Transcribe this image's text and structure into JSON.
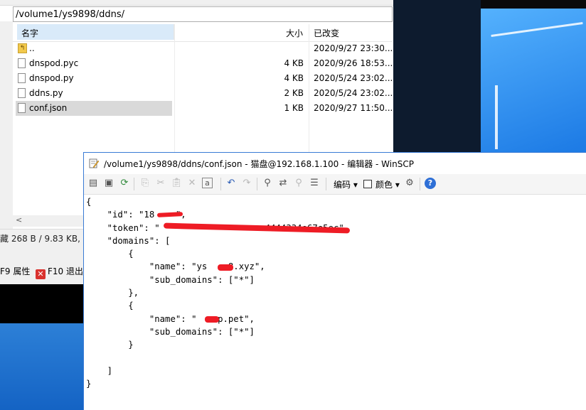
{
  "file_panel": {
    "path": "/volume1/ys9898/ddns/",
    "columns": {
      "name": "名字",
      "size": "大小",
      "modified": "已改变"
    },
    "rows": [
      {
        "name": "..",
        "size": "",
        "modified": "2020/9/27 23:30..."
      },
      {
        "name": "dnspod.pyc",
        "size": "4 KB",
        "modified": "2020/9/26 18:53..."
      },
      {
        "name": "dnspod.py",
        "size": "4 KB",
        "modified": "2020/5/24 23:02..."
      },
      {
        "name": "ddns.py",
        "size": "2 KB",
        "modified": "2020/5/24 23:02..."
      },
      {
        "name": "conf.json",
        "size": "1 KB",
        "modified": "2020/9/27 11:50..."
      }
    ],
    "status": "藏  268 B / 9.83 KB,",
    "fkeys": {
      "f9": "F9 属性",
      "f10": "F10 退出"
    }
  },
  "editor": {
    "title": "/volume1/ys9898/ddns/conf.json - 猫盘@192.168.1.100 - 编辑器 - WinSCP",
    "encoding_label": "编码 ▾",
    "color_label": "颜色 ▾",
    "help_icon": "?",
    "code_lines": [
      "{",
      "    \"id\": \"18    \",",
      "    \"token\": \"                    4444334e67e5ec\",",
      "    \"domains\": [",
      "        {",
      "            \"name\": \"ys    8.xyz\",",
      "            \"sub_domains\": [\"*\"]",
      "        },",
      "        {",
      "            \"name\": \"    p.pet\",",
      "            \"sub_domains\": [\"*\"]",
      "        }",
      "",
      "    ]",
      "}"
    ]
  },
  "colors": {
    "redaction": "#ee1c25",
    "accent": "#2e6fd6",
    "selection": "#d9d9d9"
  }
}
